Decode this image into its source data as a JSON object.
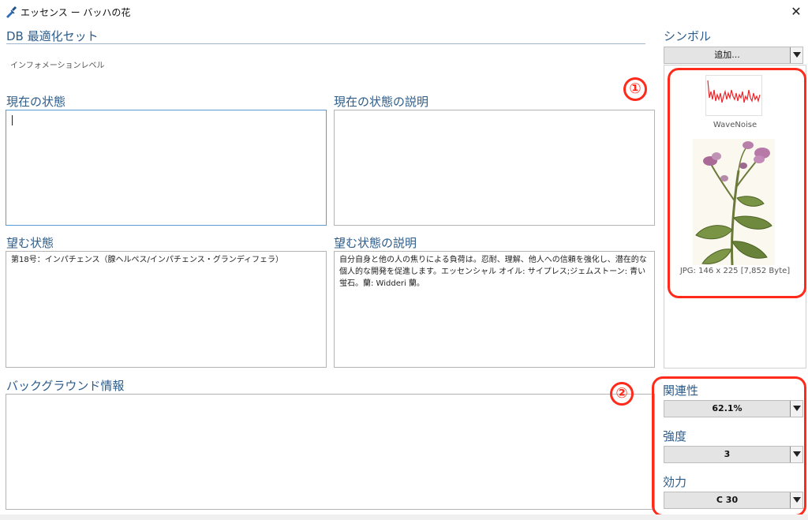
{
  "window": {
    "title": "エッセンス ー バッハの花",
    "close_glyph": "✕"
  },
  "header": {
    "db_title": "DB 最適化セット",
    "info_level": "インフォメーションレベル"
  },
  "fields": {
    "current_state": {
      "label": "現在の状態",
      "value": ""
    },
    "current_state_desc": {
      "label": "現在の状態の説明",
      "value": ""
    },
    "desired_state": {
      "label": "望む状態",
      "value": "第18号：インパチェンス（腺ヘルペス/インパチェンス・グランディフェラ）"
    },
    "desired_state_desc": {
      "label": "望む状態の説明",
      "value": "自分自身と他の人の焦りによる負荷は。忍耐、理解、他人への信頼を強化し、潜在的な個人的な開発を促進します。エッセンシャル オイル: サイプレス;ジェムストーン: 青い蛍石。蘭: Widderi 蘭。"
    },
    "background_info": {
      "label": "バックグラウンド情報",
      "value": ""
    }
  },
  "symbol": {
    "label": "シンボル",
    "add_button": "追加...",
    "wave_name": "WaveNoise",
    "image_info": "JPG: 146 x 225  [7,852 Byte]"
  },
  "annotations": {
    "one": "①",
    "two": "②"
  },
  "properties": {
    "relevance": {
      "label": "関連性",
      "value": "62.1%"
    },
    "intensity": {
      "label": "強度",
      "value": "3"
    },
    "potency": {
      "label": "効力",
      "value": "C 30"
    }
  },
  "colors": {
    "accent_label": "#2d5c8a",
    "annotation_red": "#ff2a1a",
    "focus_border": "#5b9bd5"
  }
}
